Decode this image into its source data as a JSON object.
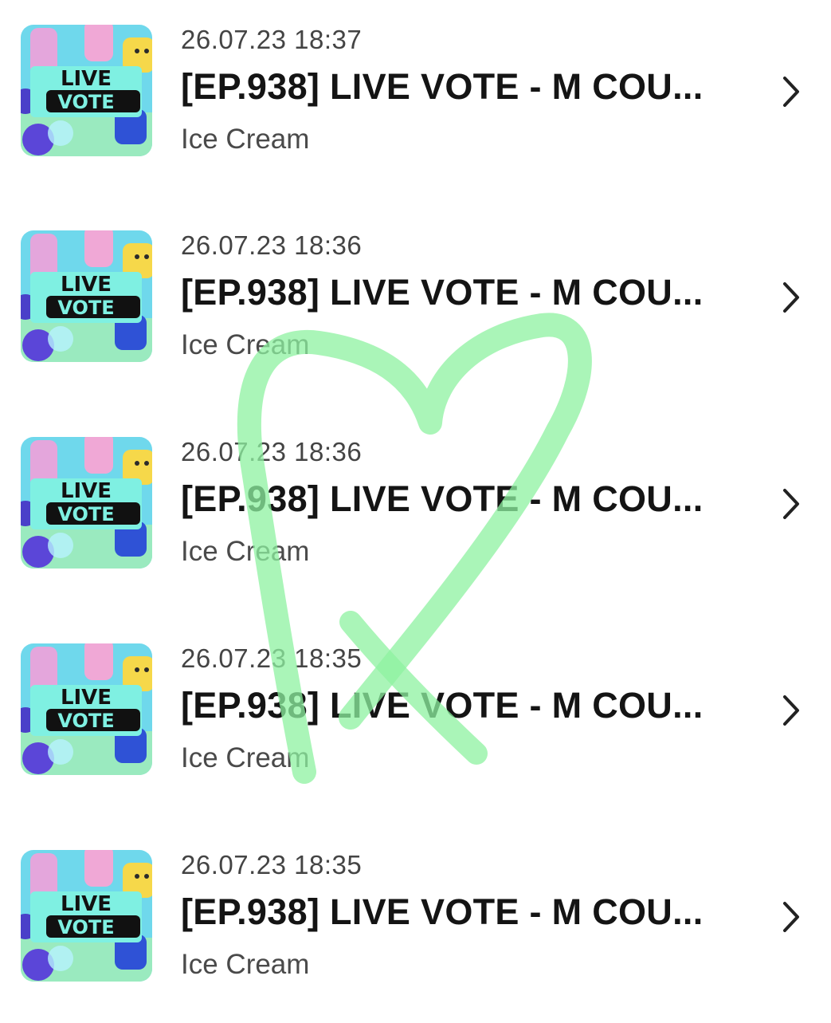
{
  "items": [
    {
      "timestamp": "26.07.23 18:37",
      "title": "[EP.938] LIVE VOTE - M COU...",
      "subtitle": "Ice Cream",
      "thumb_line1": "LIVE",
      "thumb_line2": "VOTE"
    },
    {
      "timestamp": "26.07.23 18:36",
      "title": "[EP.938] LIVE VOTE - M COU...",
      "subtitle": "Ice Cream",
      "thumb_line1": "LIVE",
      "thumb_line2": "VOTE"
    },
    {
      "timestamp": "26.07.23 18:36",
      "title": "[EP.938] LIVE VOTE - M COU...",
      "subtitle": "Ice Cream",
      "thumb_line1": "LIVE",
      "thumb_line2": "VOTE"
    },
    {
      "timestamp": "26.07.23 18:35",
      "title": "[EP.938] LIVE VOTE - M COU...",
      "subtitle": "Ice Cream",
      "thumb_line1": "LIVE",
      "thumb_line2": "VOTE"
    },
    {
      "timestamp": "26.07.23 18:35",
      "title": "[EP.938] LIVE VOTE - M COU...",
      "subtitle": "Ice Cream",
      "thumb_line1": "LIVE",
      "thumb_line2": "VOTE"
    }
  ],
  "icons": {
    "row_action": "chevron-right-icon",
    "overlay": "heart-doodle"
  },
  "colors": {
    "heart_stroke": "#8ef2a0",
    "timestamp_text": "#444444",
    "title_text": "#141414",
    "subtitle_text": "#4a4a4a"
  }
}
